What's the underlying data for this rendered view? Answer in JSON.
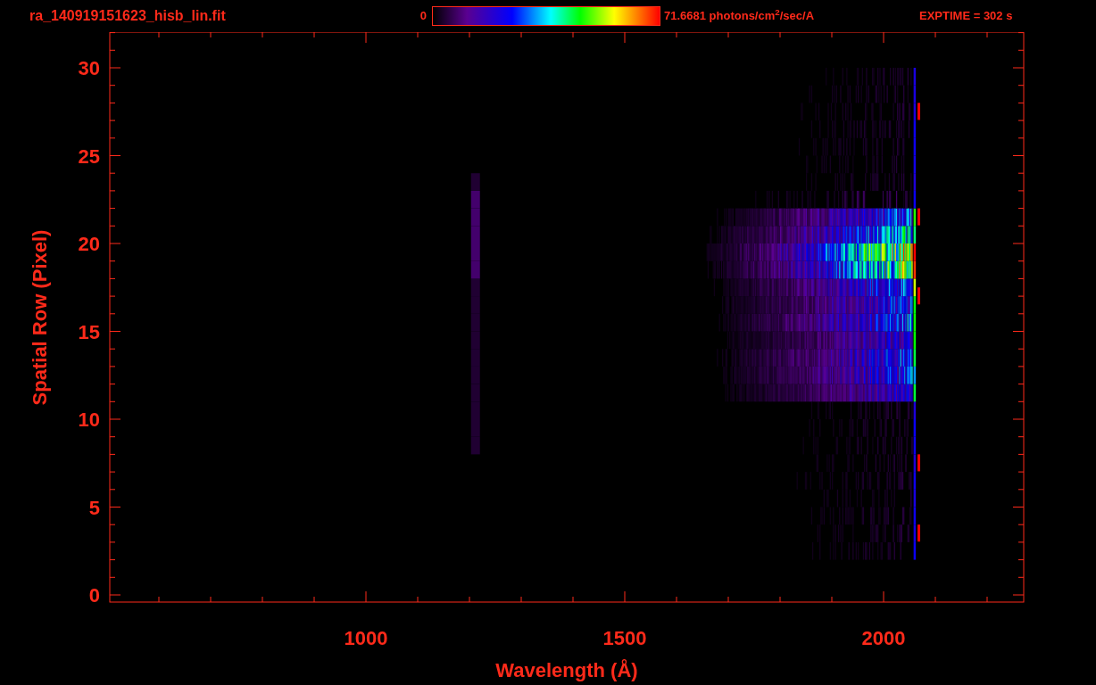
{
  "title": "ra_140919151623_hisb_lin.fit",
  "colorbar": {
    "min_label": "0",
    "max_label": "71.6681 photons/cm$^{2}$/sec/A"
  },
  "exptime": "EXPTIME = 302 s",
  "x_axis": {
    "label": "Wavelength (Å)",
    "ticks": [
      "1000",
      "1500",
      "2000"
    ]
  },
  "y_axis": {
    "label": "Spatial Row (Pixel)",
    "ticks": [
      "30",
      "25",
      "20",
      "15",
      "10",
      "5",
      "0"
    ]
  }
}
